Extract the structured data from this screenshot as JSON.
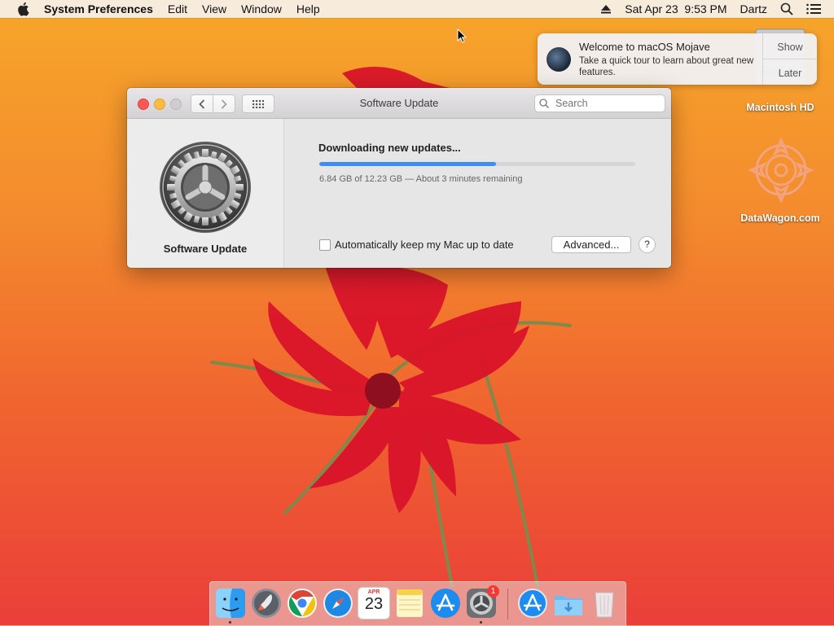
{
  "menubar": {
    "app_name": "System Preferences",
    "menus": [
      "Edit",
      "View",
      "Window",
      "Help"
    ],
    "datetime": "Sat Apr 23  9:53 PM",
    "user": "Dartz"
  },
  "notification": {
    "title": "Welcome to macOS Mojave",
    "body": "Take a quick tour to learn about great new features.",
    "show_label": "Show",
    "later_label": "Later"
  },
  "desktop": {
    "icons": [
      {
        "label": "Macintosh HD"
      },
      {
        "label": "DataWagon.com"
      }
    ]
  },
  "window": {
    "title": "Software Update",
    "search_placeholder": "Search",
    "sidebar_label": "Software Update",
    "status": "Downloading new updates...",
    "progress_fraction": 0.5593,
    "progress_text": "6.84 GB of 12.23 GB — About 3 minutes remaining",
    "auto_update_label": "Automatically keep my Mac up to date",
    "auto_update_checked": false,
    "advanced_label": "Advanced...",
    "help_label": "?"
  },
  "dock": {
    "items": [
      "Finder",
      "Launchpad",
      "Google Chrome",
      "Safari",
      "Calendar",
      "Notes",
      "App Store",
      "System Preferences",
      "Applications",
      "Downloads",
      "Trash"
    ],
    "calendar": {
      "month": "APR",
      "day": "23"
    },
    "system_prefs_badge": "1"
  },
  "colors": {
    "accent": "#3d8ef0",
    "close": "#fc5753",
    "minimize": "#fdbc40",
    "badge": "#f23a34"
  }
}
